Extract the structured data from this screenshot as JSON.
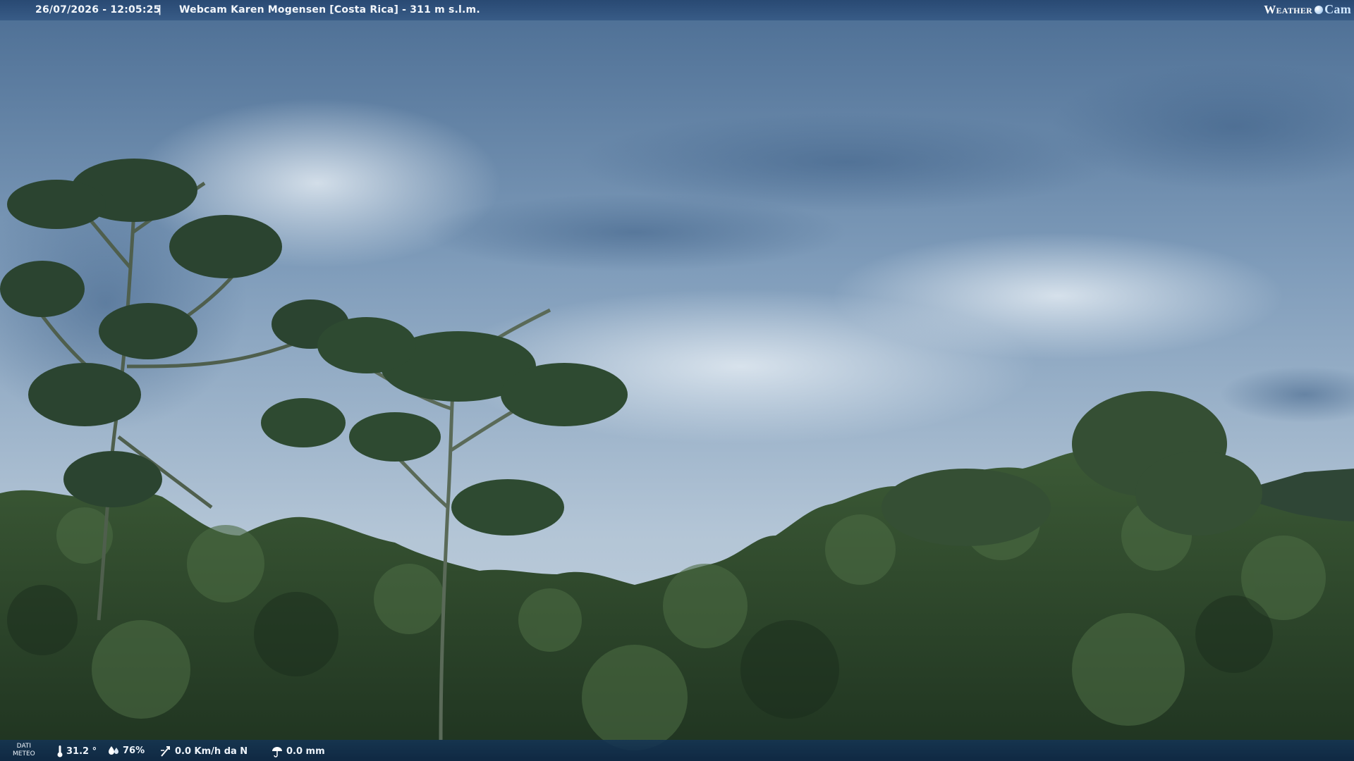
{
  "header": {
    "datetime": "26/07/2026 - 12:05:25",
    "separator": "|",
    "title": "Webcam Karen Mogensen [Costa Rica] - 311 m s.l.m."
  },
  "brand": {
    "word1": "Weather",
    "word2": "Cam",
    "icon": "globe-dot-icon"
  },
  "footer": {
    "label_line1": "DATI",
    "label_line2": "METEO",
    "temperature": "31.2 °",
    "humidity": "76%",
    "wind": "0.0 Km/h da N",
    "rain": "0.0 mm",
    "icons": [
      "thermometer-icon",
      "humidity-drops-icon",
      "wind-vane-icon",
      "rain-umbrella-icon"
    ]
  },
  "colors": {
    "sky_top": "#4d6f95",
    "sky_bottom": "#b8c9d8",
    "forest": "#2f4a2c",
    "bar": "#264670"
  }
}
